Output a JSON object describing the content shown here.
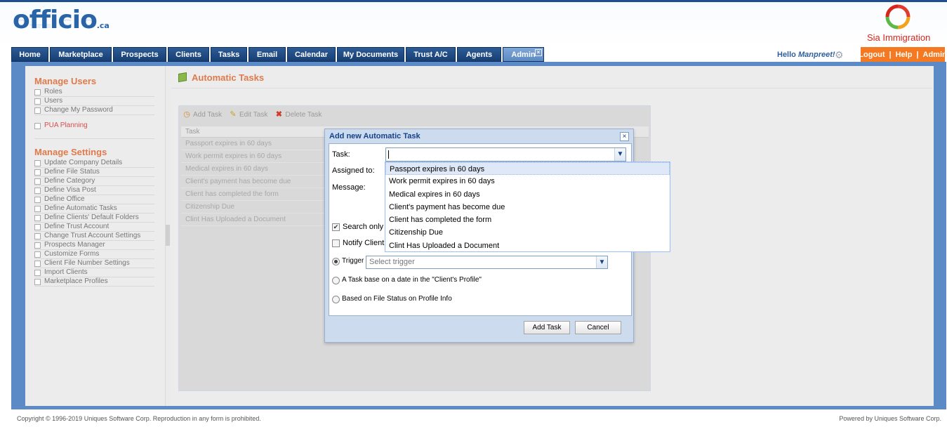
{
  "brand": {
    "logo_text": "officio",
    "logo_suffix": ".ca",
    "company": "Sia Immigration",
    "colors": {
      "primary": "#1f4f8f",
      "accent": "#f47920",
      "heading": "#de7a4b",
      "company": "#d6251b"
    }
  },
  "nav": {
    "tabs": [
      {
        "label": "Home"
      },
      {
        "label": "Marketplace"
      },
      {
        "label": "Prospects"
      },
      {
        "label": "Clients"
      },
      {
        "label": "Tasks"
      },
      {
        "label": "Email"
      },
      {
        "label": "Calendar"
      },
      {
        "label": "My Documents"
      },
      {
        "label": "Trust A/C"
      },
      {
        "label": "Agents"
      },
      {
        "label": "Admin"
      }
    ],
    "close_glyph": "×",
    "hello_prefix": "Hello",
    "user": "Manpreet!",
    "gear_icon": "gear-icon",
    "logout": "Logout",
    "help": "Help",
    "admin": "Admin",
    "sep": "|"
  },
  "sidebar": {
    "manage_users": "Manage Users",
    "user_items": [
      "Roles",
      "Users",
      "Change My Password"
    ],
    "pua": "PUA Planning",
    "manage_settings": "Manage Settings",
    "settings_items": [
      "Update Company Details",
      "Define File Status",
      "Define Category",
      "Define Visa Post",
      "Define Office",
      "Define Automatic Tasks",
      "Define Clients' Default Folders",
      "Define Trust Account",
      "Change Trust Account Settings",
      "Prospects Manager",
      "Customize Forms",
      "Client File Number Settings",
      "Import Clients",
      "Marketplace Profiles"
    ]
  },
  "main": {
    "title": "Automatic Tasks",
    "toolbar": {
      "add": "Add Task",
      "edit": "Edit Task",
      "delete": "Delete Task"
    },
    "grid_header": "Task",
    "rows": [
      "Passport expires in 60 days",
      "Work permit expires in 60 days",
      "Medical expires in 60 days",
      "Client's payment has become due",
      "Client has completed the form",
      "Citizenship Due",
      "Clint Has Uploaded a Document"
    ]
  },
  "modal": {
    "title": "Add new Automatic Task",
    "close": "×",
    "task_label": "Task:",
    "assigned_label": "Assigned to:",
    "message_label": "Message:",
    "task_value": "",
    "options": [
      "Passport expires in 60 days",
      "Work permit expires in 60 days",
      "Medical expires in 60 days",
      "Client's payment has become due",
      "Client has completed the form",
      "Citizenship Due",
      "Clint Has Uploaded a Document"
    ],
    "search_only": "Search only a",
    "notify_client": "Notify Client",
    "trigger_label": "Trigger",
    "trigger_placeholder": "Select trigger",
    "date_task": "A Task base on a date in the \"Client's Profile\"",
    "file_status": "Based on File Status on Profile Info",
    "add_btn": "Add Task",
    "cancel_btn": "Cancel"
  },
  "footer": {
    "copyright": "Copyright © 1996-2019 Uniques Software Corp.  Reproduction in any form is prohibited.",
    "powered": "Powered by Uniques Software Corp."
  }
}
